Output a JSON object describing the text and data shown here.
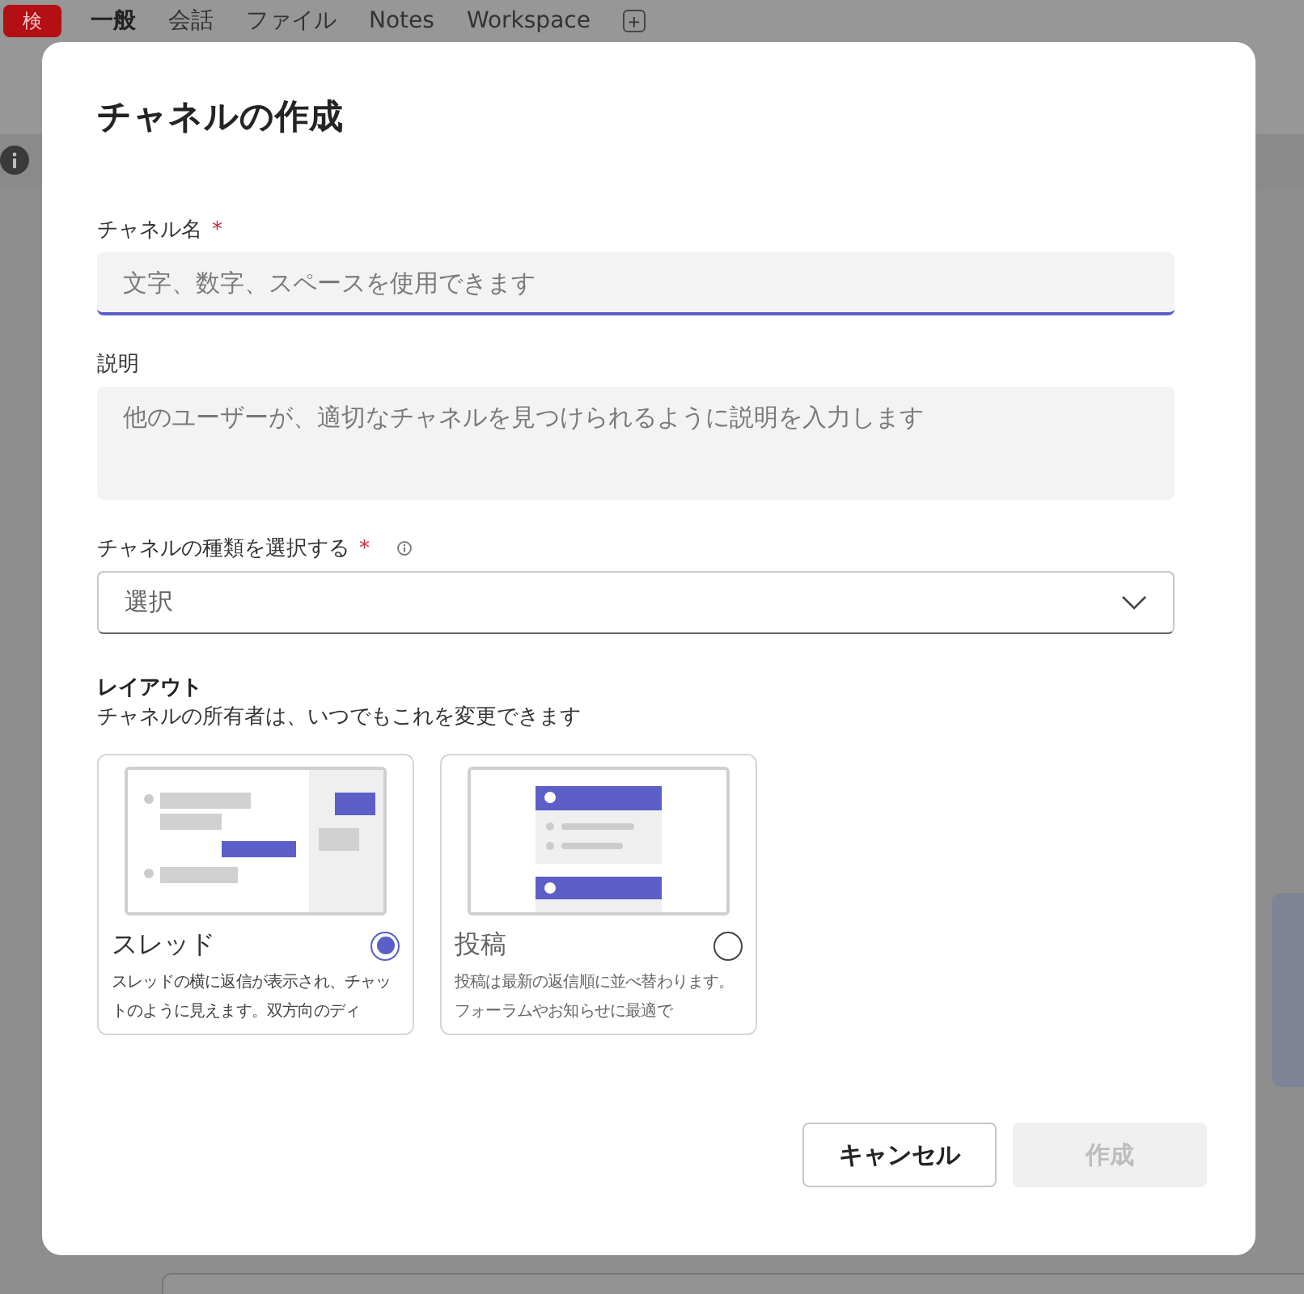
{
  "app_header": {
    "avatar": "検",
    "tabs": [
      {
        "label": "一般",
        "selected": true
      },
      {
        "label": "会話",
        "selected": false
      },
      {
        "label": "ファイル",
        "selected": false
      },
      {
        "label": "Notes",
        "selected": false
      },
      {
        "label": "Workspace",
        "selected": false
      }
    ],
    "add_tab": "+"
  },
  "dialog": {
    "title": "チャネルの作成",
    "fields": [
      {
        "kind": "input",
        "label": "チャネル名",
        "asterisk": "*",
        "placeholder": "文字、数字、スペースを使用できます"
      },
      {
        "kind": "textarea",
        "label": "説明",
        "placeholder": "他のユーザーが、適切なチャネルを見つけられるように説明を入力します"
      },
      {
        "kind": "select",
        "label": "チャネルの種類を選択する",
        "asterisk": "*",
        "info": true,
        "value": "選択"
      }
    ],
    "layout": {
      "heading": "レイアウト",
      "subtitle": "チャネルの所有者は、いつでもこれを変更できます",
      "options": [
        {
          "kind": "thread",
          "title": "スレッド",
          "description": "スレッドの横に返信が表示され、チャットのように見えます。双方向のディ",
          "selected": true
        },
        {
          "kind": "post",
          "title": "投稿",
          "description": "投稿は最新の返信順に並べ替わります。フォーラムやお知らせに最適で",
          "selected": false
        }
      ]
    },
    "buttons": [
      {
        "label": "キャンセル",
        "disabled": false
      },
      {
        "label": "作成",
        "disabled": true
      }
    ]
  }
}
